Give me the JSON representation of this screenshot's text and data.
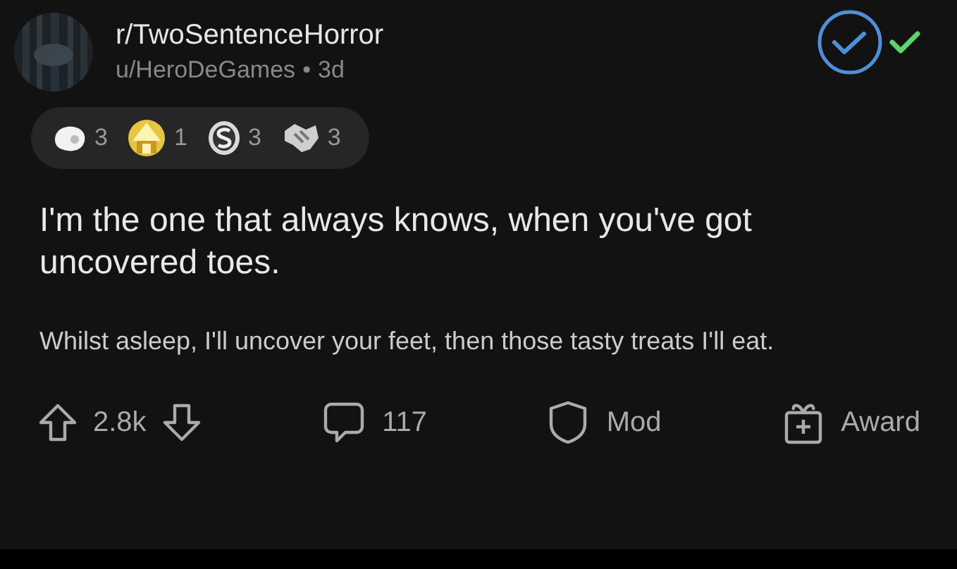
{
  "header": {
    "subreddit": "r/TwoSentenceHorror",
    "author": "u/HeroDeGames",
    "separator": "•",
    "age": "3d"
  },
  "mod_marks": [
    {
      "kind": "circle-check"
    },
    {
      "kind": "check"
    }
  ],
  "awards": [
    {
      "kind": "blob",
      "count": "3"
    },
    {
      "kind": "pyramid",
      "count": "1"
    },
    {
      "kind": "coin",
      "count": "3"
    },
    {
      "kind": "handshake",
      "count": "3"
    }
  ],
  "title": "I'm the one that always knows, when you've got uncovered toes.",
  "body": "Whilst asleep, I'll uncover your feet, then those tasty treats I'll eat.",
  "actions": [
    {
      "kind": "vote",
      "label": "2.8k"
    },
    {
      "kind": "comments",
      "label": "117"
    },
    {
      "kind": "mod",
      "label": "Mod"
    },
    {
      "kind": "award",
      "label": "Award"
    }
  ]
}
